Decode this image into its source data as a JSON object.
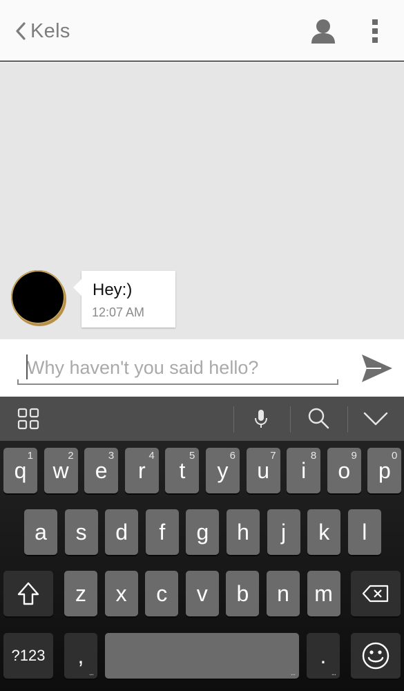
{
  "header": {
    "back_icon": "chevron-left-icon",
    "title": "Kels",
    "contact_icon": "person-icon",
    "menu_icon": "more-vert-icon"
  },
  "conversation": {
    "messages": [
      {
        "sender": "Kels",
        "text": "Hey:)",
        "time": "12:07 AM"
      }
    ]
  },
  "composer": {
    "placeholder": "Why haven't you said hello?",
    "value": "",
    "send_icon": "send-icon"
  },
  "keyboard_toolbar": {
    "icons": [
      "apps-grid-icon",
      "microphone-icon",
      "search-icon",
      "collapse-keyboard-icon"
    ]
  },
  "keyboard": {
    "row1": [
      {
        "label": "q",
        "hint": "1"
      },
      {
        "label": "w",
        "hint": "2"
      },
      {
        "label": "e",
        "hint": "3"
      },
      {
        "label": "r",
        "hint": "4"
      },
      {
        "label": "t",
        "hint": "5"
      },
      {
        "label": "y",
        "hint": "6"
      },
      {
        "label": "u",
        "hint": "7"
      },
      {
        "label": "i",
        "hint": "8"
      },
      {
        "label": "o",
        "hint": "9"
      },
      {
        "label": "p",
        "hint": "0"
      }
    ],
    "row2": [
      "a",
      "s",
      "d",
      "f",
      "g",
      "h",
      "j",
      "k",
      "l"
    ],
    "row3": [
      "z",
      "x",
      "c",
      "v",
      "b",
      "n",
      "m"
    ],
    "shift_icon": "shift-icon",
    "backspace_icon": "backspace-icon",
    "symbols_label": "?123",
    "comma_label": ",",
    "period_label": ".",
    "more_hint": "...",
    "emoji_icon": "emoji-icon"
  },
  "colors": {
    "header_bg": "#fafafa",
    "chat_bg": "#e6e6e6",
    "key_bg": "#6b6b6b",
    "key_dark_bg": "#2f2f2f",
    "toolbar_bg": "#4d4d4d"
  }
}
